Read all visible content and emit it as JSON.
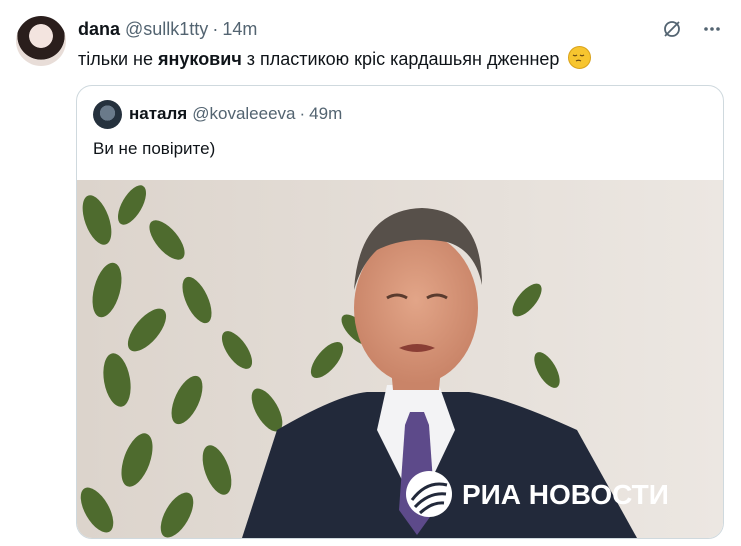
{
  "tweet": {
    "author_name": "dana",
    "author_handle": "@sullk1tty",
    "separator": "·",
    "time": "14m",
    "text_before": "тільки не",
    "text_bold": "янукович",
    "text_after": "з пластикою кріс кардашьян дженнер",
    "emoji": "pensive-face"
  },
  "quote": {
    "author_name": "наталя",
    "author_handle": "@kovaleeeva",
    "separator": "·",
    "time": "49m",
    "text": "Ви не повірите)",
    "media_watermark": "РИА НОВОСТИ"
  },
  "icons": [
    "grok-icon",
    "more-icon"
  ],
  "colors": {
    "text": "#0f1419",
    "secondary": "#536471",
    "border": "#cfd9de"
  }
}
